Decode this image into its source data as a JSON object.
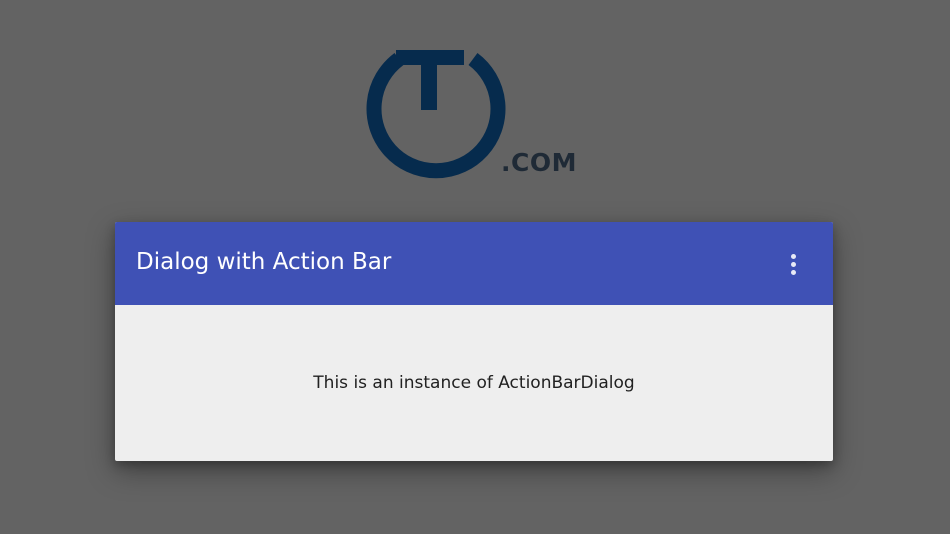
{
  "background": {
    "logo": {
      "text": ".COM",
      "icon": "timer-logo-icon",
      "color": "#062b4d"
    },
    "color": "#636363"
  },
  "dialog": {
    "action_bar": {
      "title": "Dialog with Action Bar",
      "overflow_icon": "more-vert-icon",
      "color": "#3f51b5"
    },
    "body": {
      "message": "This is an instance of ActionBarDialog"
    },
    "background_color": "#eeeeee"
  }
}
